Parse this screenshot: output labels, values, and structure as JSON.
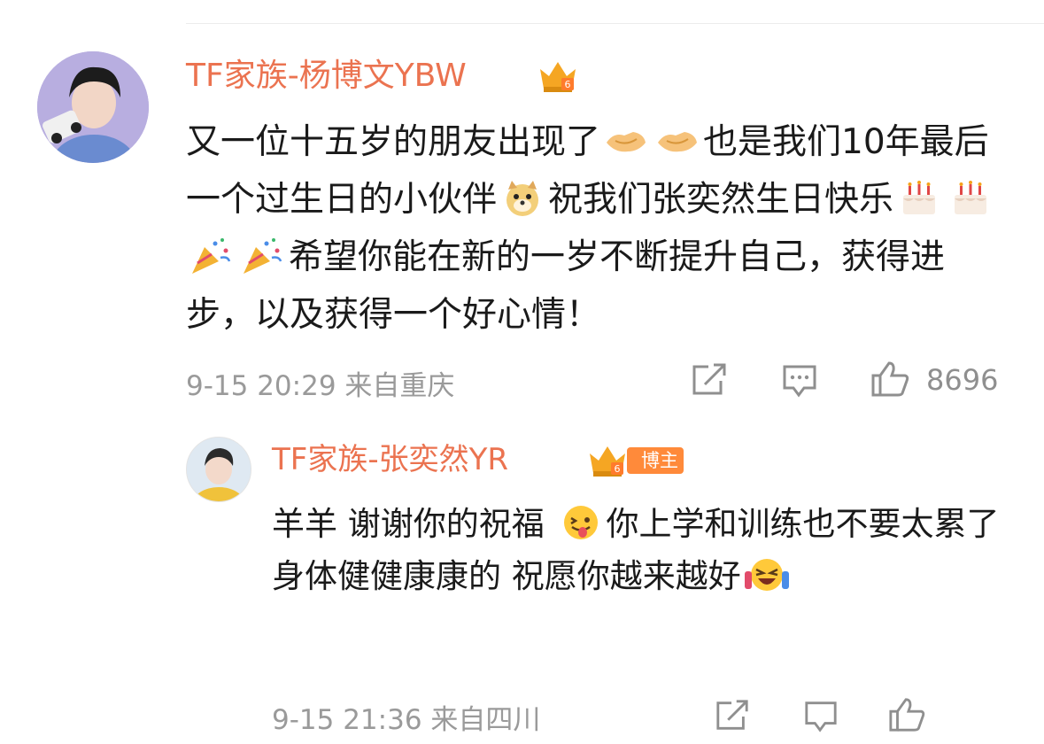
{
  "comment": {
    "username": "TF家族-杨博文YBW",
    "text_parts": {
      "p1": "又一位十五岁的朋友出现了",
      "p2": "也是我们10年最后一个过生日的小伙伴",
      "p3": "祝我们张奕然生日快乐",
      "p4": "希望你能在新的一岁不断提升自己，获得进步，以及获得一个好心情！"
    },
    "time": "9-15 20:29",
    "location": "来自重庆",
    "likes": "8696",
    "icons": [
      "handshake-emoji",
      "handshake-emoji",
      "doge-emoji",
      "cake-emoji",
      "cake-emoji",
      "party-popper-emoji",
      "party-popper-emoji"
    ]
  },
  "reply": {
    "username": "TF家族-张奕然YR",
    "badge": "博主",
    "text_parts": {
      "p1": "羊羊 谢谢你的祝福 ",
      "p2": "你上学和训练也不要太累了 身体健健康康的 祝愿你越来越好"
    },
    "time": "9-15 21:36",
    "location": "来自四川",
    "icons": [
      "tongue-out-emoji",
      "laughing-tears-emoji"
    ]
  },
  "colors": {
    "username": "#eb7350",
    "meta": "#9a9a9a",
    "text": "#1a1a1a",
    "badge": "#ff8a3a"
  }
}
